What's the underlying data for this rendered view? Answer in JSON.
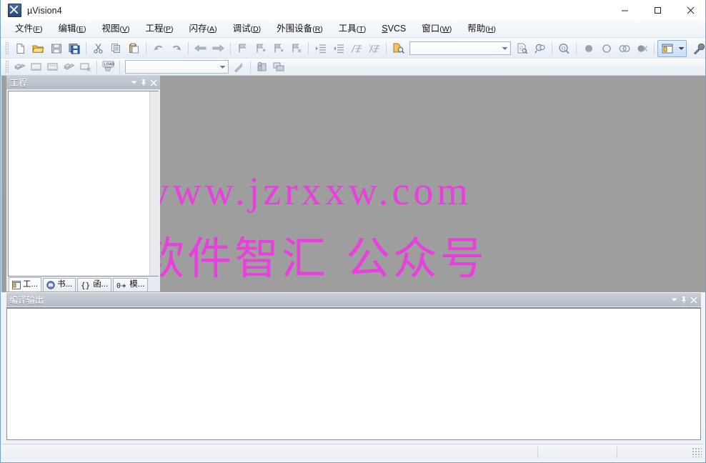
{
  "window": {
    "title": "µVision4",
    "app_icon": "uvision-logo-icon",
    "controls": {
      "minimize": "minimize-icon",
      "maximize": "maximize-icon",
      "close": "close-icon"
    }
  },
  "menubar": {
    "items": [
      {
        "label": "文件",
        "mnemonic": "F"
      },
      {
        "label": "编辑",
        "mnemonic": "E"
      },
      {
        "label": "视图",
        "mnemonic": "V"
      },
      {
        "label": "工程",
        "mnemonic": "P"
      },
      {
        "label": "闪存",
        "mnemonic": "A"
      },
      {
        "label": "调试",
        "mnemonic": "D"
      },
      {
        "label": "外围设备",
        "mnemonic": "R"
      },
      {
        "label": "工具",
        "mnemonic": "T"
      },
      {
        "label": "SVCS",
        "mnemonic": "S"
      },
      {
        "label": "窗口",
        "mnemonic": "W"
      },
      {
        "label": "帮助",
        "mnemonic": "H"
      }
    ]
  },
  "toolbar_file": {
    "buttons": [
      {
        "name": "new-file-icon",
        "tip": "New"
      },
      {
        "name": "open-file-icon",
        "tip": "Open"
      },
      {
        "name": "save-file-icon",
        "tip": "Save"
      },
      {
        "name": "save-all-icon",
        "tip": "Save All"
      },
      {
        "name": "cut-icon",
        "tip": "Cut"
      },
      {
        "name": "copy-icon",
        "tip": "Copy"
      },
      {
        "name": "paste-icon",
        "tip": "Paste"
      },
      {
        "name": "undo-icon",
        "tip": "Undo"
      },
      {
        "name": "redo-icon",
        "tip": "Redo"
      },
      {
        "name": "navigate-back-icon",
        "tip": "Back"
      },
      {
        "name": "navigate-forward-icon",
        "tip": "Forward"
      },
      {
        "name": "bookmark-toggle-icon",
        "tip": "Insert/Remove Bookmark"
      },
      {
        "name": "bookmark-prev-icon",
        "tip": "Previous Bookmark"
      },
      {
        "name": "bookmark-next-icon",
        "tip": "Next Bookmark"
      },
      {
        "name": "bookmark-clear-icon",
        "tip": "Clear All Bookmarks"
      },
      {
        "name": "indent-right-icon",
        "tip": "Indent"
      },
      {
        "name": "indent-left-icon",
        "tip": "Outdent"
      },
      {
        "name": "comment-icon",
        "tip": "Comment"
      },
      {
        "name": "uncomment-icon",
        "tip": "Uncomment"
      },
      {
        "name": "find-in-files-icon",
        "tip": "Find in Files"
      }
    ],
    "find_combo": {
      "value": "",
      "placeholder": ""
    },
    "after_combo": [
      {
        "name": "incremental-find-icon",
        "tip": "Incremental Find"
      },
      {
        "name": "find-in-files-alt-icon",
        "tip": "Find in Files"
      },
      {
        "name": "browse-symbols-icon",
        "tip": "Browse Symbols"
      }
    ],
    "debug_buttons": [
      {
        "name": "breakpoint-insert-icon",
        "tip": "Insert/Remove Breakpoint"
      },
      {
        "name": "breakpoint-enable-icon",
        "tip": "Enable/Disable Breakpoint"
      },
      {
        "name": "breakpoint-disable-all-icon",
        "tip": "Disable All Breakpoints"
      },
      {
        "name": "breakpoint-kill-all-icon",
        "tip": "Kill All Breakpoints"
      }
    ],
    "window_layout": {
      "name": "window-layout-icon",
      "dropdown": "chevron-down-icon",
      "selected": true
    },
    "configure_button": {
      "name": "wrench-icon",
      "tip": "Configuration"
    }
  },
  "toolbar_build": {
    "buttons": [
      {
        "name": "translate-icon",
        "tip": "Translate"
      },
      {
        "name": "build-target-icon",
        "tip": "Build Target"
      },
      {
        "name": "rebuild-all-icon",
        "tip": "Rebuild All Target Files"
      },
      {
        "name": "batch-build-icon",
        "tip": "Batch Build"
      },
      {
        "name": "stop-build-icon",
        "tip": "Stop Build"
      },
      {
        "name": "download-load-icon",
        "tip": "Download",
        "label": "LOAD"
      }
    ],
    "target_combo": {
      "value": "",
      "placeholder": ""
    },
    "after_combo": [
      {
        "name": "target-options-wand-icon",
        "tip": "Options for Target"
      },
      {
        "name": "manage-components-icon",
        "tip": "Manage Components"
      },
      {
        "name": "manage-multi-project-icon",
        "tip": "Manage Multi-Project Workspace"
      }
    ]
  },
  "project_panel": {
    "title": "工程",
    "header_buttons": [
      {
        "name": "panel-menu-chevron-icon"
      },
      {
        "name": "pin-icon"
      },
      {
        "name": "close-icon"
      }
    ],
    "tree_items": [],
    "tabs": [
      {
        "label": "工...",
        "icon": "project-tree-icon",
        "selected": true
      },
      {
        "label": "书...",
        "icon": "books-icon",
        "selected": false
      },
      {
        "label": "函...",
        "icon": "braces-icon",
        "selected": false
      },
      {
        "label": "模...",
        "icon": "templates-icon",
        "selected": false
      }
    ]
  },
  "workspace": {
    "watermark_line1": "www.jzrxxw.com",
    "watermark_line2": "软件智汇 公众号",
    "watermark_color": "#e740dd",
    "background_color": "#9e9e9e"
  },
  "output_panel": {
    "title": "编译输出",
    "content": "",
    "header_buttons": [
      {
        "name": "panel-menu-chevron-icon"
      },
      {
        "name": "pin-icon"
      },
      {
        "name": "close-icon"
      }
    ],
    "hscroll": {
      "left_arrow": "scroll-left-icon"
    }
  },
  "statusbar": {
    "cells": [
      "",
      "",
      "",
      ""
    ],
    "grip": "resize-grip-icon"
  }
}
